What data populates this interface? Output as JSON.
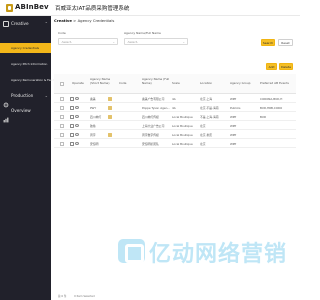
{
  "header": {
    "logo_text": "ABInBev",
    "system_title": "百威亚太IAT品质采购管理系统"
  },
  "sidebar": {
    "groups": [
      {
        "label": "Creative",
        "icon": "grid-icon"
      },
      {
        "label": "Production",
        "icon": "gear-icon"
      },
      {
        "label": "Overview",
        "icon": "chart-icon"
      }
    ],
    "items": [
      {
        "label": "Agency Credentials",
        "active": true
      },
      {
        "label": "Agency Pitch Information",
        "active": false
      },
      {
        "label": "Agency Remuneration & Feedback",
        "active": false
      }
    ]
  },
  "breadcrumb": {
    "root": "Creative",
    "separator": " > ",
    "current": "Agency Credentials"
  },
  "filters": {
    "code_label": "Code",
    "code_placeholder": "-Select-",
    "name_label": "Agency Name/Full Name",
    "name_placeholder": "-Select-"
  },
  "buttons": {
    "search": "Search",
    "reset": "Reset",
    "add": "Add",
    "delete": "Delete"
  },
  "table": {
    "headers": {
      "operate": "Operate",
      "short_name": "Agency Name (Short Name)",
      "code": "Code",
      "full_name": "Agency Name (Full Name)",
      "scale": "Scale",
      "location": "Location",
      "agency_group": "Agency Group",
      "preferred": "Preferred AB Events"
    },
    "rows": [
      {
        "short_name": "奥美",
        "full_name": "奥美广告有限公司",
        "scale": "4A",
        "location": "北京,上海",
        "group": "WPP",
        "preferred": "CORONA,BUD,H"
      },
      {
        "short_name": "PWY",
        "full_name": "Poppe Tyson Agen...",
        "scale": "4A",
        "location": "北京,不是,海南",
        "group": "Publicis",
        "preferred": "BUD,HRB,CORO"
      },
      {
        "short_name": "四川神灯",
        "full_name": "四川神灯传媒",
        "scale": "Local Boutique",
        "location": "不是,上海,海南",
        "group": "WPP",
        "preferred": "BUD"
      },
      {
        "short_name": "独角",
        "full_name": "上海大业广告公司",
        "scale": "Local Boutique",
        "location": "北京",
        "group": "WPP",
        "preferred": ""
      },
      {
        "short_name": "周宇",
        "full_name": "周宇数字传媒",
        "scale": "Local Boutique",
        "location": "北京,重庆",
        "group": "WPP",
        "preferred": ""
      },
      {
        "short_name": "安恒明",
        "full_name": "安恒明星团队",
        "scale": "Local Boutique",
        "location": "北京",
        "group": "WPP",
        "preferred": ""
      }
    ]
  },
  "footer": {
    "total": "总 6 条",
    "selected": "0 Item Selected"
  },
  "watermark": {
    "text": "亿动网络营销",
    "icon": "bank-icon"
  },
  "colors": {
    "accent": "#f5bf26",
    "sidebar_bg": "#21212b",
    "watermark": "#bfe6f6"
  }
}
